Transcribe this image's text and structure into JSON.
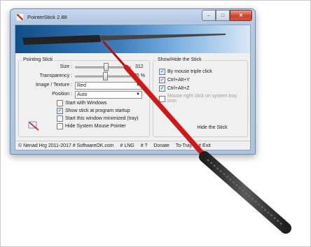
{
  "window": {
    "title": "PointerStick 2.88",
    "minimize": "–",
    "maximize": "□",
    "close": "✕"
  },
  "pointing_stick": {
    "group_label": "Pointing Stick",
    "size_label": "Size :",
    "size_value": "312",
    "transparency_label": "Transparency :",
    "transparency_value": "25 %",
    "image_label": "Image / Texture :",
    "image_value": "Red",
    "position_label": "Position :",
    "position_value": "Auto",
    "start_windows": "Start with Windows",
    "show_stick": "Show stick at program startup",
    "start_minimized": "Start this window minimized (tray)",
    "hide_pointer": "Hide System Mouse Pointer"
  },
  "show_hide": {
    "group_label": "Show/Hide the Stick",
    "triple_click": "By mouse triple click",
    "ctrl_alt_y": "Ctrl+Alt+Y",
    "ctrl_alt_z": "Ctrl+Alt+Z",
    "tray_click": "Mouse right click on system tray icon",
    "hide_button": "Hide the Stick"
  },
  "footer": {
    "copyright": "© Nenad Hrg 2011-2017 # SoftwareOK.com",
    "lng": "# LNG",
    "help": "# ?",
    "donate": "Donate",
    "to_tray": "To-Tray",
    "exit": "# Exit"
  },
  "colors": {
    "stick_red": "#d01818",
    "stick_grip": "#3a3a3a",
    "banner": "#1f5f9e",
    "accent": "#1e5aa8"
  }
}
